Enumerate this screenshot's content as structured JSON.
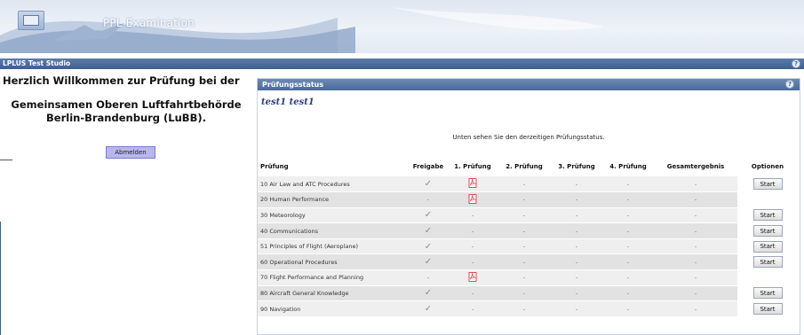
{
  "header": {
    "app_title": "PPL Examination"
  },
  "studio_bar": {
    "title": "LPLUS Test Studio"
  },
  "left": {
    "welcome_line1": "Herzlich Willkommen zur Prüfung bei der",
    "welcome_line2": "Gemeinsamen Oberen Luftfahrtbehörde",
    "welcome_line3": "Berlin-Brandenburg (LuBB).",
    "logout_label": "Abmelden"
  },
  "panel": {
    "title": "Prüfungsstatus",
    "user": "test1 test1",
    "info": "Unten sehen Sie den derzeitigen Prüfungsstatus.",
    "columns": [
      "Prüfung",
      "Freigabe",
      "1. Prüfung",
      "2. Prüfung",
      "3. Prüfung",
      "4. Prüfung",
      "Gesamtergebnis",
      "Optionen"
    ],
    "rows": [
      {
        "name": "10 Air Law and ATC Procedures",
        "freigabe": "check",
        "p1": "pdf",
        "p2": "-",
        "p3": "-",
        "p4": "-",
        "gesamt": "-",
        "option": "Start"
      },
      {
        "name": "20 Human Performance",
        "freigabe": "-",
        "p1": "pdf",
        "p2": "-",
        "p3": "-",
        "p4": "-",
        "gesamt": "-",
        "option": ""
      },
      {
        "name": "30 Meteorology",
        "freigabe": "check",
        "p1": "-",
        "p2": "-",
        "p3": "-",
        "p4": "-",
        "gesamt": "-",
        "option": "Start"
      },
      {
        "name": "40 Communications",
        "freigabe": "check",
        "p1": "-",
        "p2": "-",
        "p3": "-",
        "p4": "-",
        "gesamt": "-",
        "option": "Start"
      },
      {
        "name": "51 Principles of Flight (Aeroplane)",
        "freigabe": "check",
        "p1": "-",
        "p2": "-",
        "p3": "-",
        "p4": "-",
        "gesamt": "-",
        "option": "Start"
      },
      {
        "name": "60 Operational Procedures",
        "freigabe": "check",
        "p1": "-",
        "p2": "-",
        "p3": "-",
        "p4": "-",
        "gesamt": "-",
        "option": "Start"
      },
      {
        "name": "70 Flight Performance and Planning",
        "freigabe": "-",
        "p1": "pdf",
        "p2": "-",
        "p3": "-",
        "p4": "-",
        "gesamt": "-",
        "option": ""
      },
      {
        "name": "80 Aircraft General Knowledge",
        "freigabe": "check",
        "p1": "-",
        "p2": "-",
        "p3": "-",
        "p4": "-",
        "gesamt": "-",
        "option": "Start"
      },
      {
        "name": "90 Navigation",
        "freigabe": "check",
        "p1": "-",
        "p2": "-",
        "p3": "-",
        "p4": "-",
        "gesamt": "-",
        "option": "Start"
      }
    ]
  },
  "icons": {
    "check": "checkmark-icon",
    "pdf": "pdf-icon",
    "help": "help-icon"
  },
  "colors": {
    "header_blue": "#4a6a9a",
    "logout_button": "#b7b7ec",
    "pdf_red": "#d9262b"
  }
}
